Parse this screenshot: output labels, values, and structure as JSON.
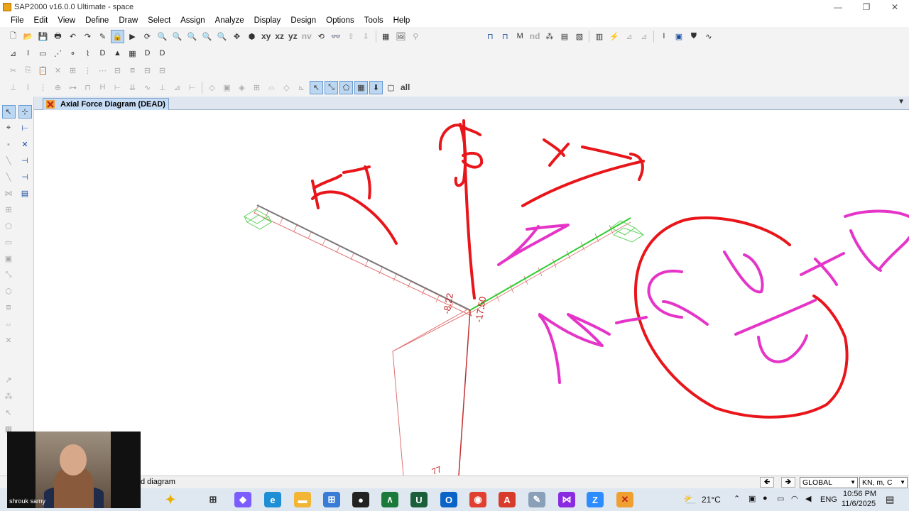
{
  "window": {
    "title": "SAP2000 v16.0.0 Ultimate  - space",
    "controls": [
      "—",
      "❐",
      "✕"
    ]
  },
  "menu": [
    "File",
    "Edit",
    "View",
    "Define",
    "Draw",
    "Select",
    "Assign",
    "Analyze",
    "Display",
    "Design",
    "Options",
    "Tools",
    "Help"
  ],
  "toolbar": {
    "view_buttons": [
      "xy",
      "xz",
      "yz",
      "nv"
    ],
    "nd_label": "nd",
    "select_all_label": "all"
  },
  "tab": {
    "label": "Axial Force Diagram  (DEAD)",
    "dropdown": "▼"
  },
  "diagram": {
    "values": [
      "-8.22",
      "-17.50"
    ],
    "partial_label": "77",
    "ink_colors": {
      "red": "#e8161b",
      "magenta": "#e535c8"
    },
    "member_colors": {
      "gray": "#7a7a7a",
      "red_fill": "#e07070",
      "green": "#2ecc2e",
      "support": "#5fd35f"
    }
  },
  "statusbar": {
    "text": "d diagram",
    "nav_left": "🡸",
    "nav_right": "🡺",
    "coord_system": "GLOBAL",
    "units": "KN, m, C"
  },
  "taskbar": {
    "weather": "21°C",
    "lang": "ENG",
    "time": "10:56 PM",
    "date": "11/6/2025"
  },
  "webcam": {
    "name": "shrouk samy"
  }
}
